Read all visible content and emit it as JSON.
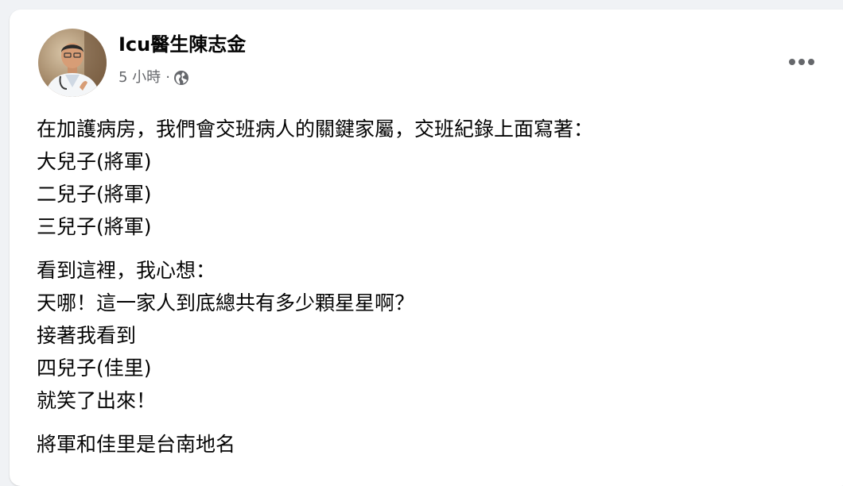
{
  "post": {
    "author": "Icu醫生陳志金",
    "time": "5 小時",
    "separator": "·",
    "audience_icon": "globe-icon",
    "more_icon": "more-options-icon",
    "paragraphs": [
      [
        "在加護病房，我們會交班病人的關鍵家屬，交班紀錄上面寫著：",
        "大兒子(將軍)",
        "二兒子(將軍)",
        "三兒子(將軍)"
      ],
      [
        "看到這裡，我心想：",
        "天哪！這一家人到底總共有多少顆星星啊？",
        "接著我看到",
        "四兒子(佳里)",
        "就笑了出來！"
      ],
      [
        "將軍和佳里是台南地名"
      ]
    ]
  },
  "colors": {
    "page_bg": "#f0f2f5",
    "card_bg": "#ffffff",
    "text_primary": "#050505",
    "text_secondary": "#65676b"
  }
}
